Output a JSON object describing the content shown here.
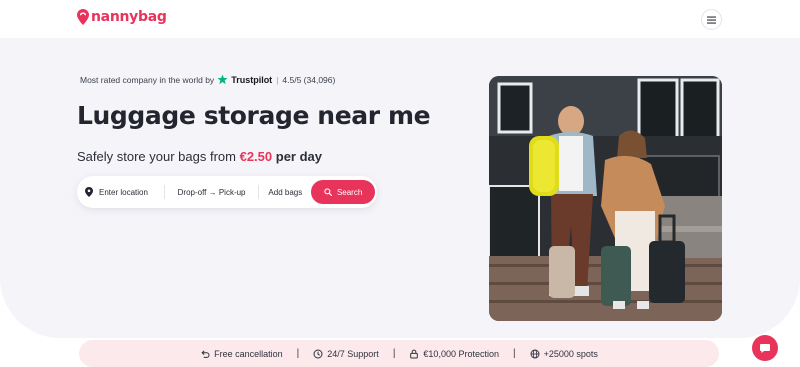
{
  "brand": {
    "name": "nannybag",
    "color": "#e8335a"
  },
  "header": {
    "menu_icon": "hamburger-icon"
  },
  "hero": {
    "trust_prefix": "Most rated company in the world by",
    "trust_brand": "Trustpilot",
    "trust_separator": "|",
    "trust_rating": "4.5/5 (34,096)",
    "title": "Luggage storage near me",
    "subtitle_prefix": "Safely store your bags from",
    "subtitle_price": "€2.50",
    "subtitle_suffix": "per day"
  },
  "search": {
    "location_label": "Enter location",
    "dates_label": "Drop-off → Pick-up",
    "bags_label": "Add bags",
    "button_label": "Search"
  },
  "features": [
    {
      "icon": "undo-icon",
      "label": "Free cancellation"
    },
    {
      "icon": "clock-icon",
      "label": "24/7 Support"
    },
    {
      "icon": "lock-icon",
      "label": "€10,000 Protection"
    },
    {
      "icon": "globe-icon",
      "label": "+25000 spots"
    }
  ],
  "feature_separator": "|",
  "chat": {
    "icon": "chat-icon"
  }
}
